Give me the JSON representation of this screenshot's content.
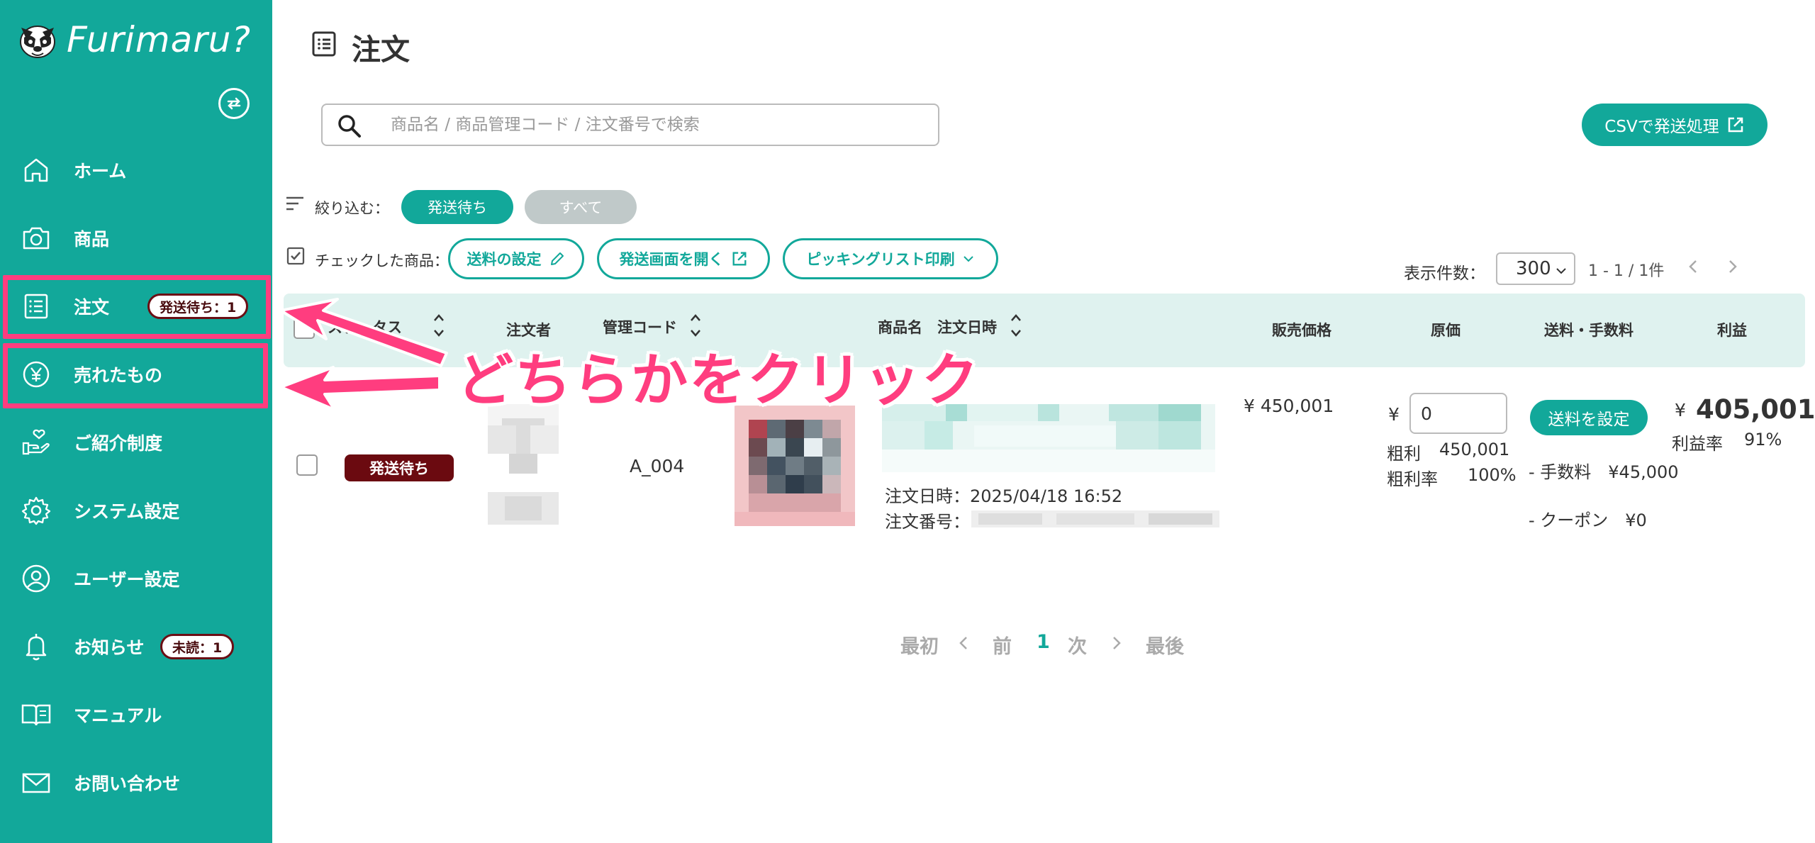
{
  "app": {
    "name": "Furimaru?"
  },
  "sidebar": {
    "items": [
      {
        "label": "ホーム",
        "icon": "home-icon"
      },
      {
        "label": "商品",
        "icon": "camera-icon"
      },
      {
        "label": "注文",
        "icon": "list-icon",
        "badge": "発送待ち：1"
      },
      {
        "label": "売れたもの",
        "icon": "yen-icon"
      },
      {
        "label": "ご紹介制度",
        "icon": "hand-heart-icon"
      },
      {
        "label": "システム設定",
        "icon": "gear-icon"
      },
      {
        "label": "ユーザー設定",
        "icon": "user-icon"
      },
      {
        "label": "お知らせ",
        "icon": "bell-icon",
        "badge": "未読：1"
      },
      {
        "label": "マニュアル",
        "icon": "book-icon"
      },
      {
        "label": "お問い合わせ",
        "icon": "mail-icon"
      }
    ]
  },
  "page": {
    "title": "注文"
  },
  "search": {
    "placeholder": "商品名 / 商品管理コード / 注文番号で検索",
    "value": ""
  },
  "toolbar": {
    "csv_label": "CSVで発送処理"
  },
  "filter": {
    "label": "絞り込む：",
    "options": [
      "発送待ち",
      "すべて"
    ],
    "selected": "発送待ち"
  },
  "bulk": {
    "label": "チェックした商品：",
    "actions": [
      "送料の設定",
      "発送画面を開く",
      "ピッキングリスト印刷"
    ]
  },
  "pagination_top": {
    "per_page_label": "表示件数：",
    "per_page": "300",
    "range": "1 - 1 / 1件"
  },
  "table": {
    "headers": {
      "status": "ステータス",
      "orderer": "注文者",
      "code": "管理コード",
      "product": "商品名",
      "order_date": "注文日時",
      "price": "販売価格",
      "cost": "原価",
      "shipping": "送料・手数料",
      "profit": "利益"
    },
    "rows": [
      {
        "status": "発送待ち",
        "code": "A_004",
        "order_date_label": "注文日時：2025/04/18 16:52",
        "order_no_label": "注文番号：",
        "price": "¥ 450,001",
        "cost_currency": "¥",
        "cost_value": "0",
        "gross_profit_label": "粗利",
        "gross_profit": "450,001",
        "gross_rate_label": "粗利率",
        "gross_rate": "100%",
        "ship_button": "送料を設定",
        "fee_line": "- 手数料　¥45,000",
        "coupon_line": "- クーポン　¥0",
        "profit_currency": "¥",
        "profit": "405,001",
        "profit_rate_label": "利益率",
        "profit_rate": "91%"
      }
    ]
  },
  "pagination_bottom": {
    "first": "最初",
    "prev": "前",
    "current": "1",
    "next": "次",
    "last": "最後"
  },
  "annotation": {
    "text": "どちらかをクリック"
  },
  "colors": {
    "brand": "#12a89a",
    "annotation": "#ff3d7f",
    "status_badge": "#6b0a10",
    "header_bg": "#dff2ef"
  }
}
